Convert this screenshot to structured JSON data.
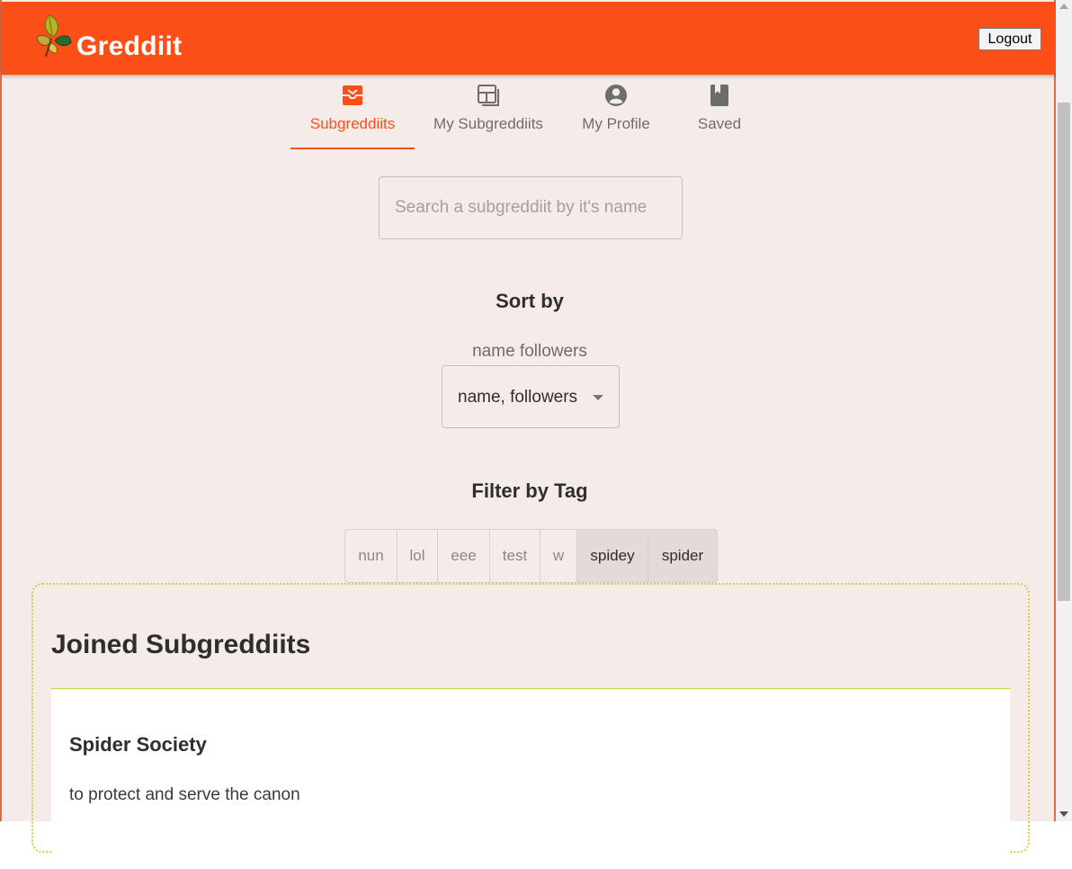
{
  "app": {
    "brand": "Greddiit",
    "logout_label": "Logout"
  },
  "tabs": [
    {
      "label": "Subgreddiits",
      "icon": "inbox-icon",
      "active": true
    },
    {
      "label": "My Subgreddiits",
      "icon": "dashboard-icon",
      "active": false
    },
    {
      "label": "My Profile",
      "icon": "account-circle-icon",
      "active": false
    },
    {
      "label": "Saved",
      "icon": "bookmark-book-icon",
      "active": false
    }
  ],
  "search": {
    "placeholder": "Search a subgreddiit by it's name",
    "value": ""
  },
  "sort": {
    "heading": "Sort by",
    "caption": "name followers",
    "selected": "name, followers"
  },
  "filter": {
    "heading": "Filter by Tag",
    "tags": [
      {
        "label": "nun",
        "selected": false
      },
      {
        "label": "lol",
        "selected": false
      },
      {
        "label": "eee",
        "selected": false
      },
      {
        "label": "test",
        "selected": false
      },
      {
        "label": "w",
        "selected": false
      },
      {
        "label": "spidey",
        "selected": true
      },
      {
        "label": "spider",
        "selected": true
      }
    ]
  },
  "joined": {
    "title": "Joined Subgreddiits",
    "items": [
      {
        "name": "Spider Society",
        "description": "to protect and serve the canon"
      }
    ]
  },
  "colors": {
    "accent": "#fc4f18",
    "background": "#f5ecea",
    "tag_selected": "#e4dad8"
  }
}
